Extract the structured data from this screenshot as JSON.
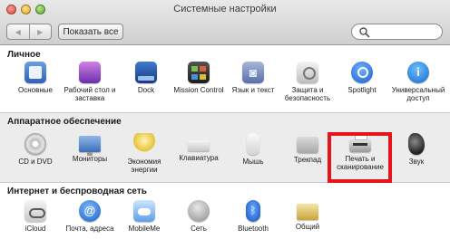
{
  "window": {
    "title": "Системные настройки",
    "back_glyph": "◀",
    "forward_glyph": "▶",
    "show_all_label": "Показать все",
    "search_placeholder": ""
  },
  "sections": {
    "personal": {
      "title": "Личное",
      "items": [
        {
          "label": "Основные",
          "icon": "general-icon"
        },
        {
          "label": "Рабочий стол и заставка",
          "icon": "desktop-screensaver-icon"
        },
        {
          "label": "Dock",
          "icon": "dock-icon"
        },
        {
          "label": "Mission Control",
          "icon": "mission-control-icon"
        },
        {
          "label": "Язык и текст",
          "icon": "language-text-icon"
        },
        {
          "label": "Защита и безопасность",
          "icon": "security-icon"
        },
        {
          "label": "Spotlight",
          "icon": "spotlight-icon"
        },
        {
          "label": "Универсальный доступ",
          "icon": "universal-access-icon"
        }
      ]
    },
    "hardware": {
      "title": "Аппаратное обеспечение",
      "items": [
        {
          "label": "CD и DVD",
          "icon": "cd-dvd-icon"
        },
        {
          "label": "Мониторы",
          "icon": "displays-icon"
        },
        {
          "label": "Экономия энергии",
          "icon": "energy-saver-icon"
        },
        {
          "label": "Клавиатура",
          "icon": "keyboard-icon"
        },
        {
          "label": "Мышь",
          "icon": "mouse-icon"
        },
        {
          "label": "Трекпад",
          "icon": "trackpad-icon"
        },
        {
          "label": "Печать и сканирование",
          "icon": "print-scan-icon"
        },
        {
          "label": "Звук",
          "icon": "sound-icon"
        }
      ]
    },
    "internet": {
      "title": "Интернет и беспроводная сеть",
      "items": [
        {
          "label": "iCloud",
          "icon": "icloud-icon"
        },
        {
          "label": "Почта, адреса",
          "icon": "mail-contacts-icon"
        },
        {
          "label": "MobileMe",
          "icon": "mobileme-icon"
        },
        {
          "label": "Сеть",
          "icon": "network-icon"
        },
        {
          "label": "Bluetooth",
          "icon": "bluetooth-icon"
        },
        {
          "label": "Общий",
          "icon": "sharing-icon"
        }
      ]
    }
  },
  "colors": {
    "highlight": "#e8141b"
  }
}
